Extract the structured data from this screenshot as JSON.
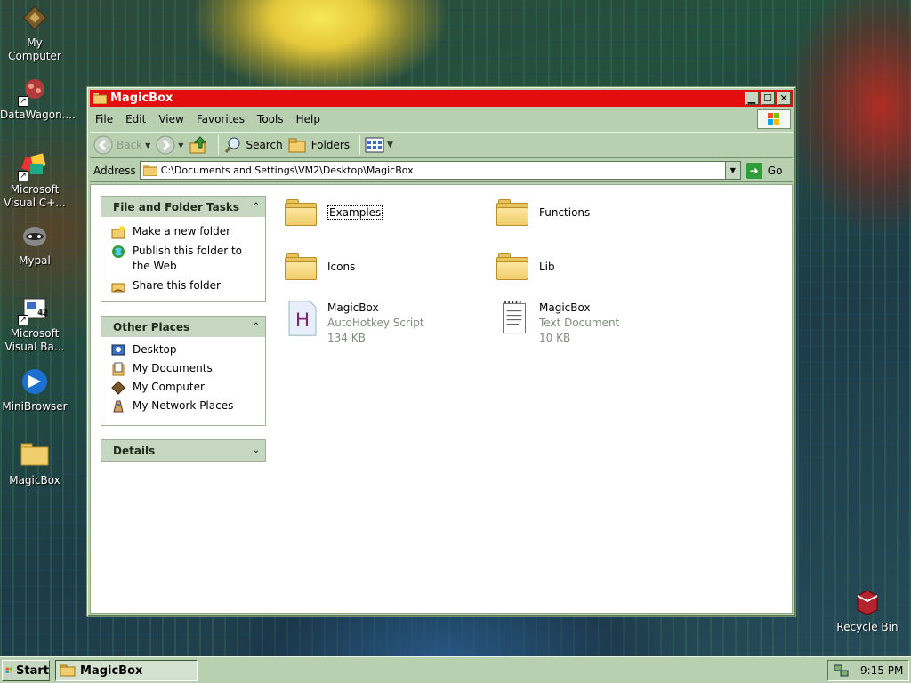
{
  "desktop": {
    "icons": [
      {
        "label": "My Computer",
        "icon": "computer-chip-icon"
      },
      {
        "label": "DataWagon....",
        "icon": "datawagon-icon"
      },
      {
        "label": "Microsoft Visual C+...",
        "icon": "visual-cpp-icon"
      },
      {
        "label": "Mypal",
        "icon": "mypal-raccoon-icon"
      },
      {
        "label": "Microsoft Visual Ba...",
        "icon": "visual-basic-icon"
      },
      {
        "label": "MiniBrowser",
        "icon": "minibrowser-icon"
      },
      {
        "label": "MagicBox",
        "icon": "folder-icon"
      },
      {
        "label": "Recycle Bin",
        "icon": "recycle-bin-icon"
      }
    ]
  },
  "window": {
    "title": "MagicBox",
    "menu": [
      "File",
      "Edit",
      "View",
      "Favorites",
      "Tools",
      "Help"
    ],
    "toolbar": {
      "back": "Back",
      "search": "Search",
      "folders": "Folders"
    },
    "address": {
      "label": "Address",
      "value": "C:\\Documents and Settings\\VM2\\Desktop\\MagicBox",
      "go": "Go"
    }
  },
  "tasks": {
    "file_folder": {
      "title": "File and Folder Tasks",
      "links": [
        "Make a new folder",
        "Publish this folder to the Web",
        "Share this folder"
      ]
    },
    "other_places": {
      "title": "Other Places",
      "links": [
        "Desktop",
        "My Documents",
        "My Computer",
        "My Network Places"
      ]
    },
    "details": {
      "title": "Details"
    }
  },
  "files": [
    {
      "name": "Examples",
      "type": "folder",
      "selected": true
    },
    {
      "name": "Functions",
      "type": "folder"
    },
    {
      "name": "Icons",
      "type": "folder"
    },
    {
      "name": "Lib",
      "type": "folder"
    },
    {
      "name": "MagicBox",
      "kind": "AutoHotkey Script",
      "size": "134 KB",
      "type": "ahk"
    },
    {
      "name": "MagicBox",
      "kind": "Text Document",
      "size": "10 KB",
      "type": "txt"
    }
  ],
  "taskbar": {
    "start": "Start",
    "task": "MagicBox",
    "clock": "9:15 PM"
  },
  "colors": {
    "titlebar": "#e30d0d",
    "chrome": "#b8cfb0",
    "pane_header": "#c6d7c1"
  }
}
